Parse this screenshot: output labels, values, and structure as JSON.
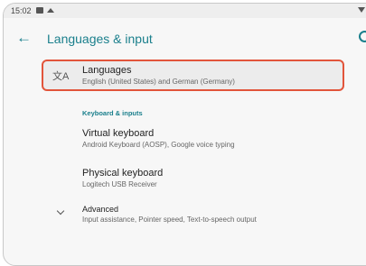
{
  "status": {
    "time": "15:02"
  },
  "header": {
    "title": "Languages & input"
  },
  "languages": {
    "label": "Languages",
    "summary": "English (United States) and German (Germany)"
  },
  "section": {
    "title": "Keyboard & inputs"
  },
  "virtual_keyboard": {
    "label": "Virtual keyboard",
    "summary": "Android Keyboard (AOSP), Google voice typing"
  },
  "physical_keyboard": {
    "label": "Physical keyboard",
    "summary": "Logitech USB Receiver"
  },
  "advanced": {
    "label": "Advanced",
    "summary": "Input assistance, Pointer speed, Text-to-speech output"
  },
  "colors": {
    "accent": "#1a7f8c",
    "highlight": "#e2553b"
  }
}
